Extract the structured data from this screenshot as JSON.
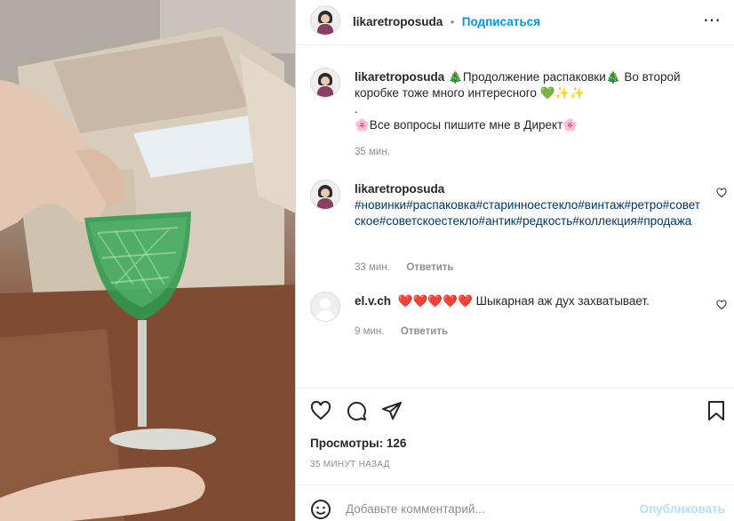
{
  "post": {
    "username": "likaretroposuda",
    "follow_dot": "•",
    "follow_label": "Подписаться",
    "more_label": "⋯"
  },
  "caption": {
    "username": "likaretroposuda",
    "line1": "🎄Продолжение распаковки🎄 Во второй коробке тоже много интересного 💚✨✨",
    "line2": ".",
    "line3": "🌸Все вопросы пишите мне в Директ🌸",
    "time": "35 мин."
  },
  "comments": [
    {
      "username": "likaretroposuda",
      "text": "#новинки#распаковка#старинноестекло#винтаж#ретро#советское#советскоестекло#антик#редкость#коллекция#продажа",
      "time": "33 мин.",
      "reply_label": "Ответить"
    },
    {
      "username": "el.v.ch",
      "text": "❤️❤️❤️❤️❤️ Шыкарная аж дух захватывает.",
      "time": "9 мин.",
      "reply_label": "Ответить"
    }
  ],
  "actions": {
    "like_icon": "heart-icon",
    "comment_icon": "comment-icon",
    "share_icon": "share-icon",
    "save_icon": "bookmark-icon"
  },
  "stats": {
    "views": "Просмотры: 126",
    "ago": "35 МИНУТ НАЗАД"
  },
  "comment_box": {
    "placeholder": "Добавьте комментарий...",
    "publish_label": "Опубликовать"
  },
  "colors": {
    "link_blue": "#0095f6",
    "hashtag": "#00376b",
    "publish_disabled": "#b2dffc",
    "meta_gray": "#8e8e8e"
  }
}
